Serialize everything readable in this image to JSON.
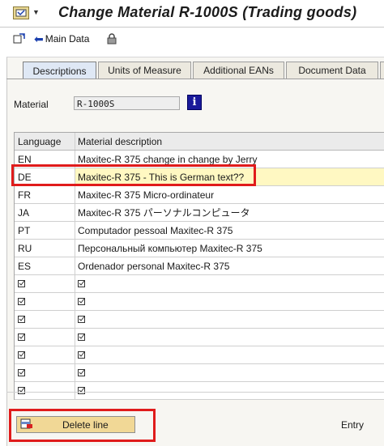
{
  "window": {
    "title": "Change Material R-1000S (Trading goods)"
  },
  "toolbar": {
    "main_data_label": "Main Data"
  },
  "tabs": [
    {
      "label": "Descriptions"
    },
    {
      "label": "Units of Measure"
    },
    {
      "label": "Additional EANs"
    },
    {
      "label": "Document Data"
    }
  ],
  "material": {
    "label": "Material",
    "value": "R-1000S"
  },
  "table": {
    "headers": [
      "Language",
      "Material description"
    ],
    "rows": [
      {
        "lang": "EN",
        "desc": "Maxitec-R 375 change in change by Jerry"
      },
      {
        "lang": "DE",
        "desc": "Maxitec-R 375 - This is German text??"
      },
      {
        "lang": "FR",
        "desc": "Maxitec-R 375 Micro-ordinateur"
      },
      {
        "lang": "JA",
        "desc": "Maxitec-R 375 パーソナルコンピュータ"
      },
      {
        "lang": "PT",
        "desc": "Computador pessoal Maxitec-R 375"
      },
      {
        "lang": "RU",
        "desc": "Персональный компьютер Maxitec-R 375"
      },
      {
        "lang": "ES",
        "desc": "Ordenador personal Maxitec-R 375"
      }
    ]
  },
  "footer": {
    "delete_label": "Delete line",
    "entry_label": "Entry"
  },
  "colors": {
    "highlight": "#e01b1b",
    "selected_row": "#fff8c2",
    "active_tab": "#dfe8f5"
  }
}
